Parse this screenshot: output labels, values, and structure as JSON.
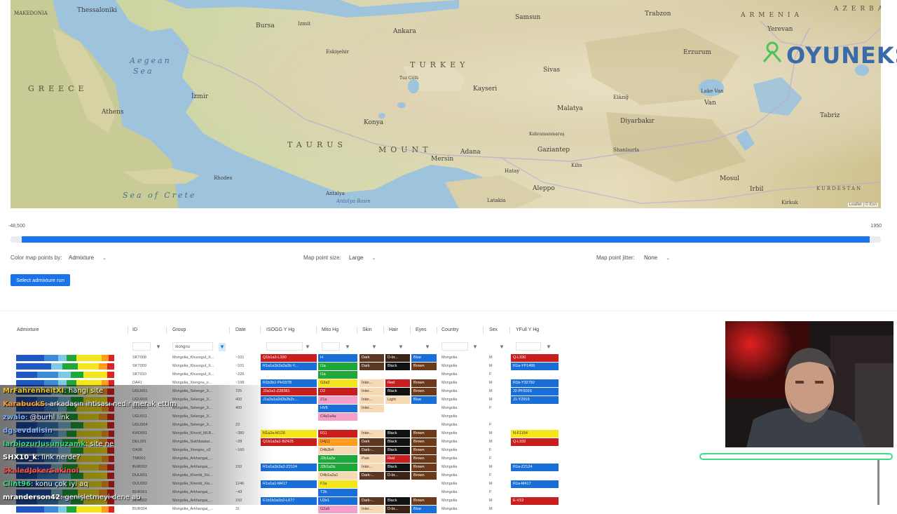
{
  "map": {
    "labels": [
      {
        "text": "Thessaloniki"
      },
      {
        "text": "MAKEDONIA"
      },
      {
        "text": "Bursa"
      },
      {
        "text": "Ankara"
      },
      {
        "text": "Aegean"
      },
      {
        "text": "Sea"
      },
      {
        "text": "GREECE"
      },
      {
        "text": "Athens"
      },
      {
        "text": "İzmir"
      },
      {
        "text": "TURKEY"
      },
      {
        "text": "Konya"
      },
      {
        "text": "Kayseri"
      },
      {
        "text": "TAURUS"
      },
      {
        "text": "MOUNT"
      },
      {
        "text": "Adana"
      },
      {
        "text": "Gaziantep"
      },
      {
        "text": "Antalya"
      },
      {
        "text": "Mersin"
      },
      {
        "text": "Aleppo"
      },
      {
        "text": "Diyarbakır"
      },
      {
        "text": "Erzurum"
      },
      {
        "text": "Trabzon"
      },
      {
        "text": "Van"
      },
      {
        "text": "Yerevan"
      },
      {
        "text": "ARMENIA"
      },
      {
        "text": "AZERBA"
      },
      {
        "text": "Tabriz"
      },
      {
        "text": "Mosul"
      },
      {
        "text": "Irbil"
      },
      {
        "text": "Sea of Crete"
      },
      {
        "text": "Antalya Basin"
      },
      {
        "text": "Lake Van"
      },
      {
        "text": "Malatya"
      },
      {
        "text": "Sivas"
      },
      {
        "text": "Samsun"
      },
      {
        "text": "Rhodes"
      },
      {
        "text": "Kilis"
      },
      {
        "text": "Shanlıurfa"
      },
      {
        "text": "Kirkuk"
      },
      {
        "text": "KURDESTAN"
      },
      {
        "text": "Elâzığ"
      },
      {
        "text": "Hatay"
      },
      {
        "text": "Latakia"
      },
      {
        "text": "Izmit"
      },
      {
        "text": "Eskişehir"
      },
      {
        "text": "Tuz Gölü"
      },
      {
        "text": "Kahramanmaraş"
      }
    ],
    "attribution": "Leaflet | © Esri",
    "watermark": "OYUNEKS"
  },
  "slider": {
    "min_label": "-48,500",
    "max_label": "1950"
  },
  "controls": {
    "color_label": "Color map points by:",
    "color_value": "Admixture",
    "size_label": "Map point size:",
    "size_value": "Large",
    "jitter_label": "Map point jitter:",
    "jitter_value": "None",
    "admixture_button": "Select admixture run"
  },
  "table": {
    "headers": [
      "Admixture",
      "ID",
      "Group",
      "Date",
      "ISOGG Y Hg",
      "Mito Hg",
      "Skin",
      "Hair",
      "Eyes",
      "Country",
      "Sex",
      "YFull Y Hg"
    ],
    "group_filter": "xiongnu",
    "rows": [
      {
        "id": "SKT008",
        "group": "Mongolia_Khuvsgul_X...",
        "date": "~101",
        "isogg": "Q1b1a3-L330",
        "mito": "H",
        "skin": "Dark",
        "hair": "D-br...",
        "eyes": "Blue",
        "country": "Mongolia",
        "sex": "M",
        "yfull": "Q-L330"
      },
      {
        "id": "SKT009",
        "group": "Mongolia_Khuvsgul_X...",
        "date": "~101",
        "isogg": "R1a1a1b2a2a3b-Y...",
        "mito": "I1a",
        "skin": "Dark",
        "hair": "Black",
        "eyes": "Brown",
        "country": "Mongolia",
        "sex": "M",
        "yfull": "R1a-YP1455"
      },
      {
        "id": "SKT010",
        "group": "Mongolia_Khuvsgul_X...",
        "date": "~226",
        "isogg": "",
        "mito": "I1a",
        "skin": "",
        "hair": "",
        "eyes": "",
        "country": "Mongolia",
        "sex": "F",
        "yfull": ""
      },
      {
        "id": "DA41",
        "group": "Mongolia_Xiongnu_o...",
        "date": "~198",
        "isogg": "R1b2b1-PH1578",
        "mito": "G3a3",
        "skin": "Inter...",
        "hair": "Red",
        "eyes": "Brown",
        "country": "Mongolia",
        "sex": "M",
        "yfull": "R1b-Y32792"
      },
      {
        "id": "UGU001",
        "group": "Mongolia_Selenge_X...",
        "date": "725",
        "isogg": "J2a1a1-Z28381",
        "mito": "D2",
        "skin": "Inter...",
        "hair": "Black",
        "eyes": "Brown",
        "country": "Mongolia",
        "sex": "M",
        "yfull": "J2-PF5016"
      },
      {
        "id": "UGU006",
        "group": "Mongolia_Selenge_X...",
        "date": "400",
        "isogg": "J1a2a1a2d2b2b2c...",
        "mito": "Z1a",
        "skin": "Inter...",
        "hair": "Light",
        "eyes": "Blue",
        "country": "Mongolia",
        "sex": "M",
        "yfull": "J1-Y2919"
      },
      {
        "id": "UGU010",
        "group": "Mongolia_Selenge_X...",
        "date": "400",
        "isogg": "",
        "mito": "HV6",
        "skin": "Inter...",
        "hair": "",
        "eyes": "",
        "country": "Mongolia",
        "sex": "F",
        "yfull": ""
      },
      {
        "id": "UGU011",
        "group": "Mongolia_Selenge_X...",
        "date": "",
        "isogg": "",
        "mito": "C4a1a4a",
        "skin": "",
        "hair": "",
        "eyes": "",
        "country": "Mongolia",
        "sex": "",
        "yfull": ""
      },
      {
        "id": "UGU004",
        "group": "Mongolia_Selenge_X...",
        "date": "23",
        "isogg": "",
        "mito": "",
        "skin": "",
        "hair": "",
        "eyes": "",
        "country": "Mongolia",
        "sex": "F",
        "yfull": ""
      },
      {
        "id": "KHO001",
        "group": "Mongolia_Khovd_MLB...",
        "date": "~380",
        "isogg": "N1a2a-M128",
        "mito": "R11",
        "skin": "Inter...",
        "hair": "Black",
        "eyes": "Brown",
        "country": "Mongolia",
        "sex": "M",
        "yfull": "N-F1154"
      },
      {
        "id": "DEL001",
        "group": "Mongolia_Sukhbaatar...",
        "date": "~28",
        "isogg": "Q1b1a3a1-BZ425",
        "mito": "D4j11",
        "skin": "Dark",
        "hair": "Black",
        "eyes": "Brown",
        "country": "Mongolia",
        "sex": "M",
        "yfull": "Q-L332"
      },
      {
        "id": "DA38",
        "group": "Mongolia_Xiongnu_o2",
        "date": "~160",
        "isogg": "",
        "mito": "D4b2b4",
        "skin": "Dark-...",
        "hair": "Black",
        "eyes": "Brown",
        "country": "Mongolia",
        "sex": "F",
        "yfull": ""
      },
      {
        "id": "TMI001",
        "group": "Mongolia_Arkhangai_...",
        "date": "",
        "isogg": "",
        "mito": "J2b1a2a",
        "skin": "Pale",
        "hair": "Red",
        "eyes": "Brown",
        "country": "Mongolia",
        "sex": "F",
        "yfull": ""
      },
      {
        "id": "BUR003",
        "group": "Mongolia_Arkhangai_...",
        "date": "150",
        "isogg": "R1a1a1b2a2-Z2124",
        "mito": "J2b1a2a",
        "skin": "Inter...",
        "hair": "Black",
        "eyes": "Brown",
        "country": "Mongolia",
        "sex": "M",
        "yfull": "R1a-Z2124"
      },
      {
        "id": "DUU001",
        "group": "Mongolia_Khentii_Xio...",
        "date": "",
        "isogg": "",
        "mito": "D4b1a2a1",
        "skin": "Dark-...",
        "hair": "D-br...",
        "eyes": "Brown",
        "country": "Mongolia",
        "sex": "F",
        "yfull": ""
      },
      {
        "id": "DUU002",
        "group": "Mongolia_Khentii_Xio...",
        "date": "1246",
        "isogg": "R1a1a1-M417",
        "mito": "F2a",
        "skin": "",
        "hair": "",
        "eyes": "",
        "country": "Mongolia",
        "sex": "M",
        "yfull": "R1a-M417"
      },
      {
        "id": "BUR001",
        "group": "Mongolia_Arkhangai_...",
        "date": "~43",
        "isogg": "",
        "mito": "T2b",
        "skin": "",
        "hair": "",
        "eyes": "",
        "country": "Mongolia",
        "sex": "F",
        "yfull": ""
      },
      {
        "id": "BUR002",
        "group": "Mongolia_Arkhangai_...",
        "date": "150",
        "isogg": "E1b1b1a1b2-L677",
        "mito": "U2e1",
        "skin": "Dark-...",
        "hair": "Black",
        "eyes": "Brown",
        "country": "Mongolia",
        "sex": "M",
        "yfull": "E-V22"
      },
      {
        "id": "BUR004",
        "group": "Mongolia_Arkhangai_...",
        "date": "31",
        "isogg": "",
        "mito": "G2a5",
        "skin": "Inter...",
        "hair": "D-br...",
        "eyes": "Blue",
        "country": "Mongolia",
        "sex": "M",
        "yfull": ""
      }
    ]
  },
  "chat": [
    {
      "user": "MrFahrenheitXI",
      "msg": ": hangi site",
      "color": "#f0c419"
    },
    {
      "user": "KarabuckS",
      "msg": ": arkadaşın ihtisası nedir merak ettim",
      "color": "#ff9c33"
    },
    {
      "user": "zwalo",
      "msg": ": @burhl link",
      "color": "#7fb0ff"
    },
    {
      "user": "dgsevdalisin",
      "msg": "",
      "color": "#7fb0ff"
    },
    {
      "user": "larbiozurlusunuzamk",
      "msg": ": site ne",
      "color": "#3ddc84"
    },
    {
      "user": "SHX10_k",
      "msg": ": link nerde?",
      "color": "#ffffff"
    },
    {
      "user": "SkaledJokerSakinol",
      "msg": "",
      "color": "#ff4d4d"
    },
    {
      "user": "Clint96",
      "msg": ": konu çok iyi aq",
      "color": "#3ddc84"
    },
    {
      "user": "mranderson42",
      "msg": ": genişletmeyi dene ab",
      "color": "#ffffff"
    }
  ]
}
